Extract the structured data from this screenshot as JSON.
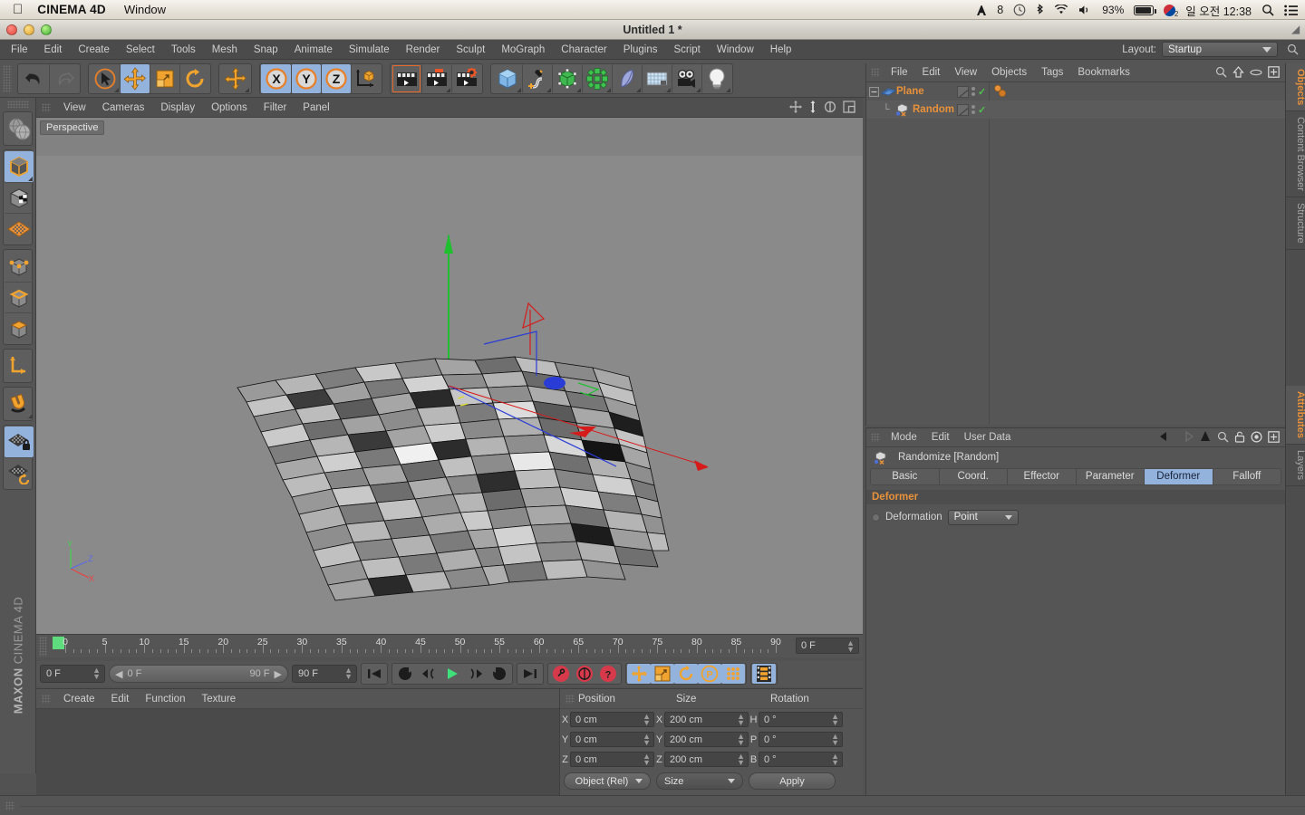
{
  "mac_menubar": {
    "apple": "apple-logo",
    "app_name": "CINEMA 4D",
    "menus": [
      "Window"
    ],
    "status": {
      "adobe_count": "8",
      "battery_percent": "93%",
      "input_source": "2",
      "clock": "일 오전 12:38"
    }
  },
  "window": {
    "title": "Untitled 1 *"
  },
  "main_menu": {
    "items": [
      "File",
      "Edit",
      "Create",
      "Select",
      "Tools",
      "Mesh",
      "Snap",
      "Animate",
      "Simulate",
      "Render",
      "Sculpt",
      "MoGraph",
      "Character",
      "Plugins",
      "Script",
      "Window",
      "Help"
    ],
    "layout_label": "Layout:",
    "layout_value": "Startup"
  },
  "toolbar": {
    "groups": [
      {
        "buttons": [
          {
            "name": "undo-icon",
            "label": "Undo",
            "selected": false
          },
          {
            "name": "redo-icon",
            "label": "Redo",
            "selected": false
          }
        ]
      },
      {
        "buttons": [
          {
            "name": "live-selection-icon",
            "label": "Live Selection",
            "selected": false
          },
          {
            "name": "move-icon",
            "label": "Move",
            "selected": true
          },
          {
            "name": "scale-icon",
            "label": "Scale",
            "selected": false
          },
          {
            "name": "rotate-icon",
            "label": "Rotate",
            "selected": false
          }
        ]
      },
      {
        "buttons": [
          {
            "name": "move-tool-icon",
            "label": "Move Tool",
            "selected": false
          }
        ]
      },
      {
        "buttons": [
          {
            "name": "axis-x-icon",
            "label": "X",
            "selected": true
          },
          {
            "name": "axis-y-icon",
            "label": "Y",
            "selected": true
          },
          {
            "name": "axis-z-icon",
            "label": "Z",
            "selected": true
          },
          {
            "name": "world-coordinate-icon",
            "label": "World/Object Coordinates",
            "selected": false
          }
        ]
      },
      {
        "buttons": [
          {
            "name": "render-view-icon",
            "label": "Render View",
            "selected": false
          },
          {
            "name": "render-to-picture-viewer-icon",
            "label": "Render to Picture Viewer",
            "selected": false
          },
          {
            "name": "render-settings-icon",
            "label": "Render Settings",
            "selected": false
          }
        ]
      },
      {
        "buttons": [
          {
            "name": "primitive-cube-icon",
            "label": "Add Cube Object",
            "selected": false
          },
          {
            "name": "spline-pen-icon",
            "label": "Add Spline",
            "selected": false
          },
          {
            "name": "generator-subdivision-icon",
            "label": "Add Generator",
            "selected": false
          },
          {
            "name": "mograph-icon",
            "label": "Add MoGraph",
            "selected": false
          },
          {
            "name": "deformer-bend-icon",
            "label": "Add Deformer",
            "selected": false
          },
          {
            "name": "scene-floor-icon",
            "label": "Add Scene Object",
            "selected": false
          },
          {
            "name": "camera-icon",
            "label": "Add Camera",
            "selected": false
          },
          {
            "name": "light-icon",
            "label": "Add Light",
            "selected": false
          }
        ]
      }
    ]
  },
  "left_toolbar": {
    "groups": [
      {
        "buttons": [
          {
            "name": "make-editable-icon",
            "label": "Make Editable",
            "selected": false
          }
        ]
      },
      {
        "buttons": [
          {
            "name": "model-mode-icon",
            "label": "Model Mode",
            "selected": true
          },
          {
            "name": "texture-mode-icon",
            "label": "Texture Mode",
            "selected": false
          },
          {
            "name": "workplane-mode-icon",
            "label": "Workplane Mode",
            "selected": false
          }
        ]
      },
      {
        "buttons": [
          {
            "name": "points-mode-icon",
            "label": "Points Mode",
            "selected": false
          },
          {
            "name": "edges-mode-icon",
            "label": "Edges Mode",
            "selected": false
          },
          {
            "name": "polygons-mode-icon",
            "label": "Polygons Mode",
            "selected": false
          }
        ]
      },
      {
        "buttons": [
          {
            "name": "axis-mode-icon",
            "label": "Enable Axis Modification",
            "selected": false
          }
        ]
      },
      {
        "buttons": [
          {
            "name": "magnet-icon",
            "label": "Magnet",
            "selected": false
          }
        ]
      },
      {
        "buttons": [
          {
            "name": "workplane-lock-icon",
            "label": "Lock Workplane",
            "selected": true
          },
          {
            "name": "workplane-rotate-icon",
            "label": "Rotate Workplane",
            "selected": false
          }
        ]
      }
    ],
    "brand_top": "MAXON",
    "brand_bottom": "CINEMA 4D"
  },
  "viewport": {
    "menu": [
      "View",
      "Cameras",
      "Display",
      "Options",
      "Filter",
      "Panel"
    ],
    "view_label": "Perspective",
    "corner_icons": [
      "pan-view-icon",
      "dolly-view-icon",
      "rotate-view-icon",
      "maximize-view-icon"
    ],
    "axis_hud": {
      "x": "X",
      "y": "Y",
      "z": "Z"
    },
    "scene_description": "Randomized polygonal Plane object with move gizmo"
  },
  "timeline": {
    "labels": [
      "0",
      "5",
      "10",
      "15",
      "20",
      "25",
      "30",
      "35",
      "40",
      "45",
      "50",
      "55",
      "60",
      "65",
      "70",
      "75",
      "80",
      "85",
      "90"
    ],
    "current_frame_field": "0 F",
    "start_frame": "0 F",
    "range_start": "0 F",
    "range_end": "90 F",
    "end_frame": "90 F"
  },
  "transport": {
    "buttons": [
      {
        "name": "go-to-start-icon",
        "label": "Go to Start",
        "selected": false
      },
      {
        "name": "play-back-icon",
        "label": "Go to Previous Key",
        "selected": false
      },
      {
        "name": "step-back-icon",
        "label": "Step Back",
        "selected": false
      },
      {
        "name": "play-forward-icon",
        "label": "Play Forward",
        "selected": false
      },
      {
        "name": "step-forward-icon",
        "label": "Step Forward",
        "selected": false
      },
      {
        "name": "go-to-next-key-icon",
        "label": "Go to Next Key",
        "selected": false
      },
      {
        "name": "go-to-end-icon",
        "label": "Go to End",
        "selected": false
      },
      {
        "name": "record-key-icon",
        "label": "Record Active Objects",
        "selected": false
      },
      {
        "name": "autokey-icon",
        "label": "Autokeying",
        "selected": false
      },
      {
        "name": "keyframe-selection-icon",
        "label": "Keyframe Selection",
        "selected": false
      },
      {
        "name": "key-position-icon",
        "label": "Position",
        "selected": true
      },
      {
        "name": "key-scale-icon",
        "label": "Scale",
        "selected": true
      },
      {
        "name": "key-rotation-icon",
        "label": "Rotation",
        "selected": true
      },
      {
        "name": "key-parameter-icon",
        "label": "Parameter",
        "selected": true
      },
      {
        "name": "key-pla-icon",
        "label": "Point Level Animation",
        "selected": true
      },
      {
        "name": "timeline-icon",
        "label": "Timeline",
        "selected": true
      }
    ]
  },
  "materials": {
    "menu": [
      "Create",
      "Edit",
      "Function",
      "Texture"
    ]
  },
  "coordinates": {
    "headers": [
      "Position",
      "Size",
      "Rotation"
    ],
    "rows": [
      {
        "pos_axis": "X",
        "pos_value": "0 cm",
        "size_axis": "X",
        "size_value": "200 cm",
        "rot_axis": "H",
        "rot_value": "0 °"
      },
      {
        "pos_axis": "Y",
        "pos_value": "0 cm",
        "size_axis": "Y",
        "size_value": "200 cm",
        "rot_axis": "P",
        "rot_value": "0 °"
      },
      {
        "pos_axis": "Z",
        "pos_value": "0 cm",
        "size_axis": "Z",
        "size_value": "200 cm",
        "rot_axis": "B",
        "rot_value": "0 °"
      }
    ],
    "mode_dropdown": "Object (Rel)",
    "size_dropdown": "Size",
    "apply_button": "Apply"
  },
  "object_manager": {
    "menu": [
      "File",
      "Edit",
      "View",
      "Objects",
      "Tags",
      "Bookmarks"
    ],
    "header_icons": [
      "search-icon",
      "up-arrow-icon",
      "ellipse-icon",
      "plus-box-icon"
    ],
    "objects": [
      {
        "name": "Plane",
        "icon": "plane-object-icon",
        "indent": 0,
        "has_expander": true,
        "tags": [
          "mograph-tag-icon"
        ]
      },
      {
        "name": "Random",
        "icon": "random-effector-icon",
        "indent": 1,
        "has_expander": false,
        "tags": []
      }
    ]
  },
  "attributes": {
    "menu": [
      "Mode",
      "Edit",
      "User Data"
    ],
    "header_icons": [
      "back-arrow-icon",
      "forward-arrow-icon",
      "up-arrow-icon",
      "search-icon",
      "lock-icon",
      "target-icon",
      "plus-box-icon"
    ],
    "object_title": "Randomize [Random]",
    "tabs": [
      {
        "label": "Basic",
        "active": false
      },
      {
        "label": "Coord.",
        "active": false
      },
      {
        "label": "Effector",
        "active": false
      },
      {
        "label": "Parameter",
        "active": false
      },
      {
        "label": "Deformer",
        "active": true
      },
      {
        "label": "Falloff",
        "active": false
      }
    ],
    "section_title": "Deformer",
    "fields": [
      {
        "label": "Deformation",
        "value": "Point",
        "type": "dropdown"
      }
    ]
  },
  "right_tabs": {
    "top": [
      {
        "label": "Objects",
        "active": true
      },
      {
        "label": "Content Browser",
        "active": false
      },
      {
        "label": "Structure",
        "active": false
      }
    ],
    "bottom": [
      {
        "label": "Attributes",
        "active": true
      },
      {
        "label": "Layers",
        "active": false
      }
    ]
  },
  "colors": {
    "panel_bg": "#555555",
    "selected_blue": "#93b2dc",
    "accent_orange": "#e8913a",
    "viewport_bg": "#8a8a8a",
    "field_bg": "#454545"
  }
}
